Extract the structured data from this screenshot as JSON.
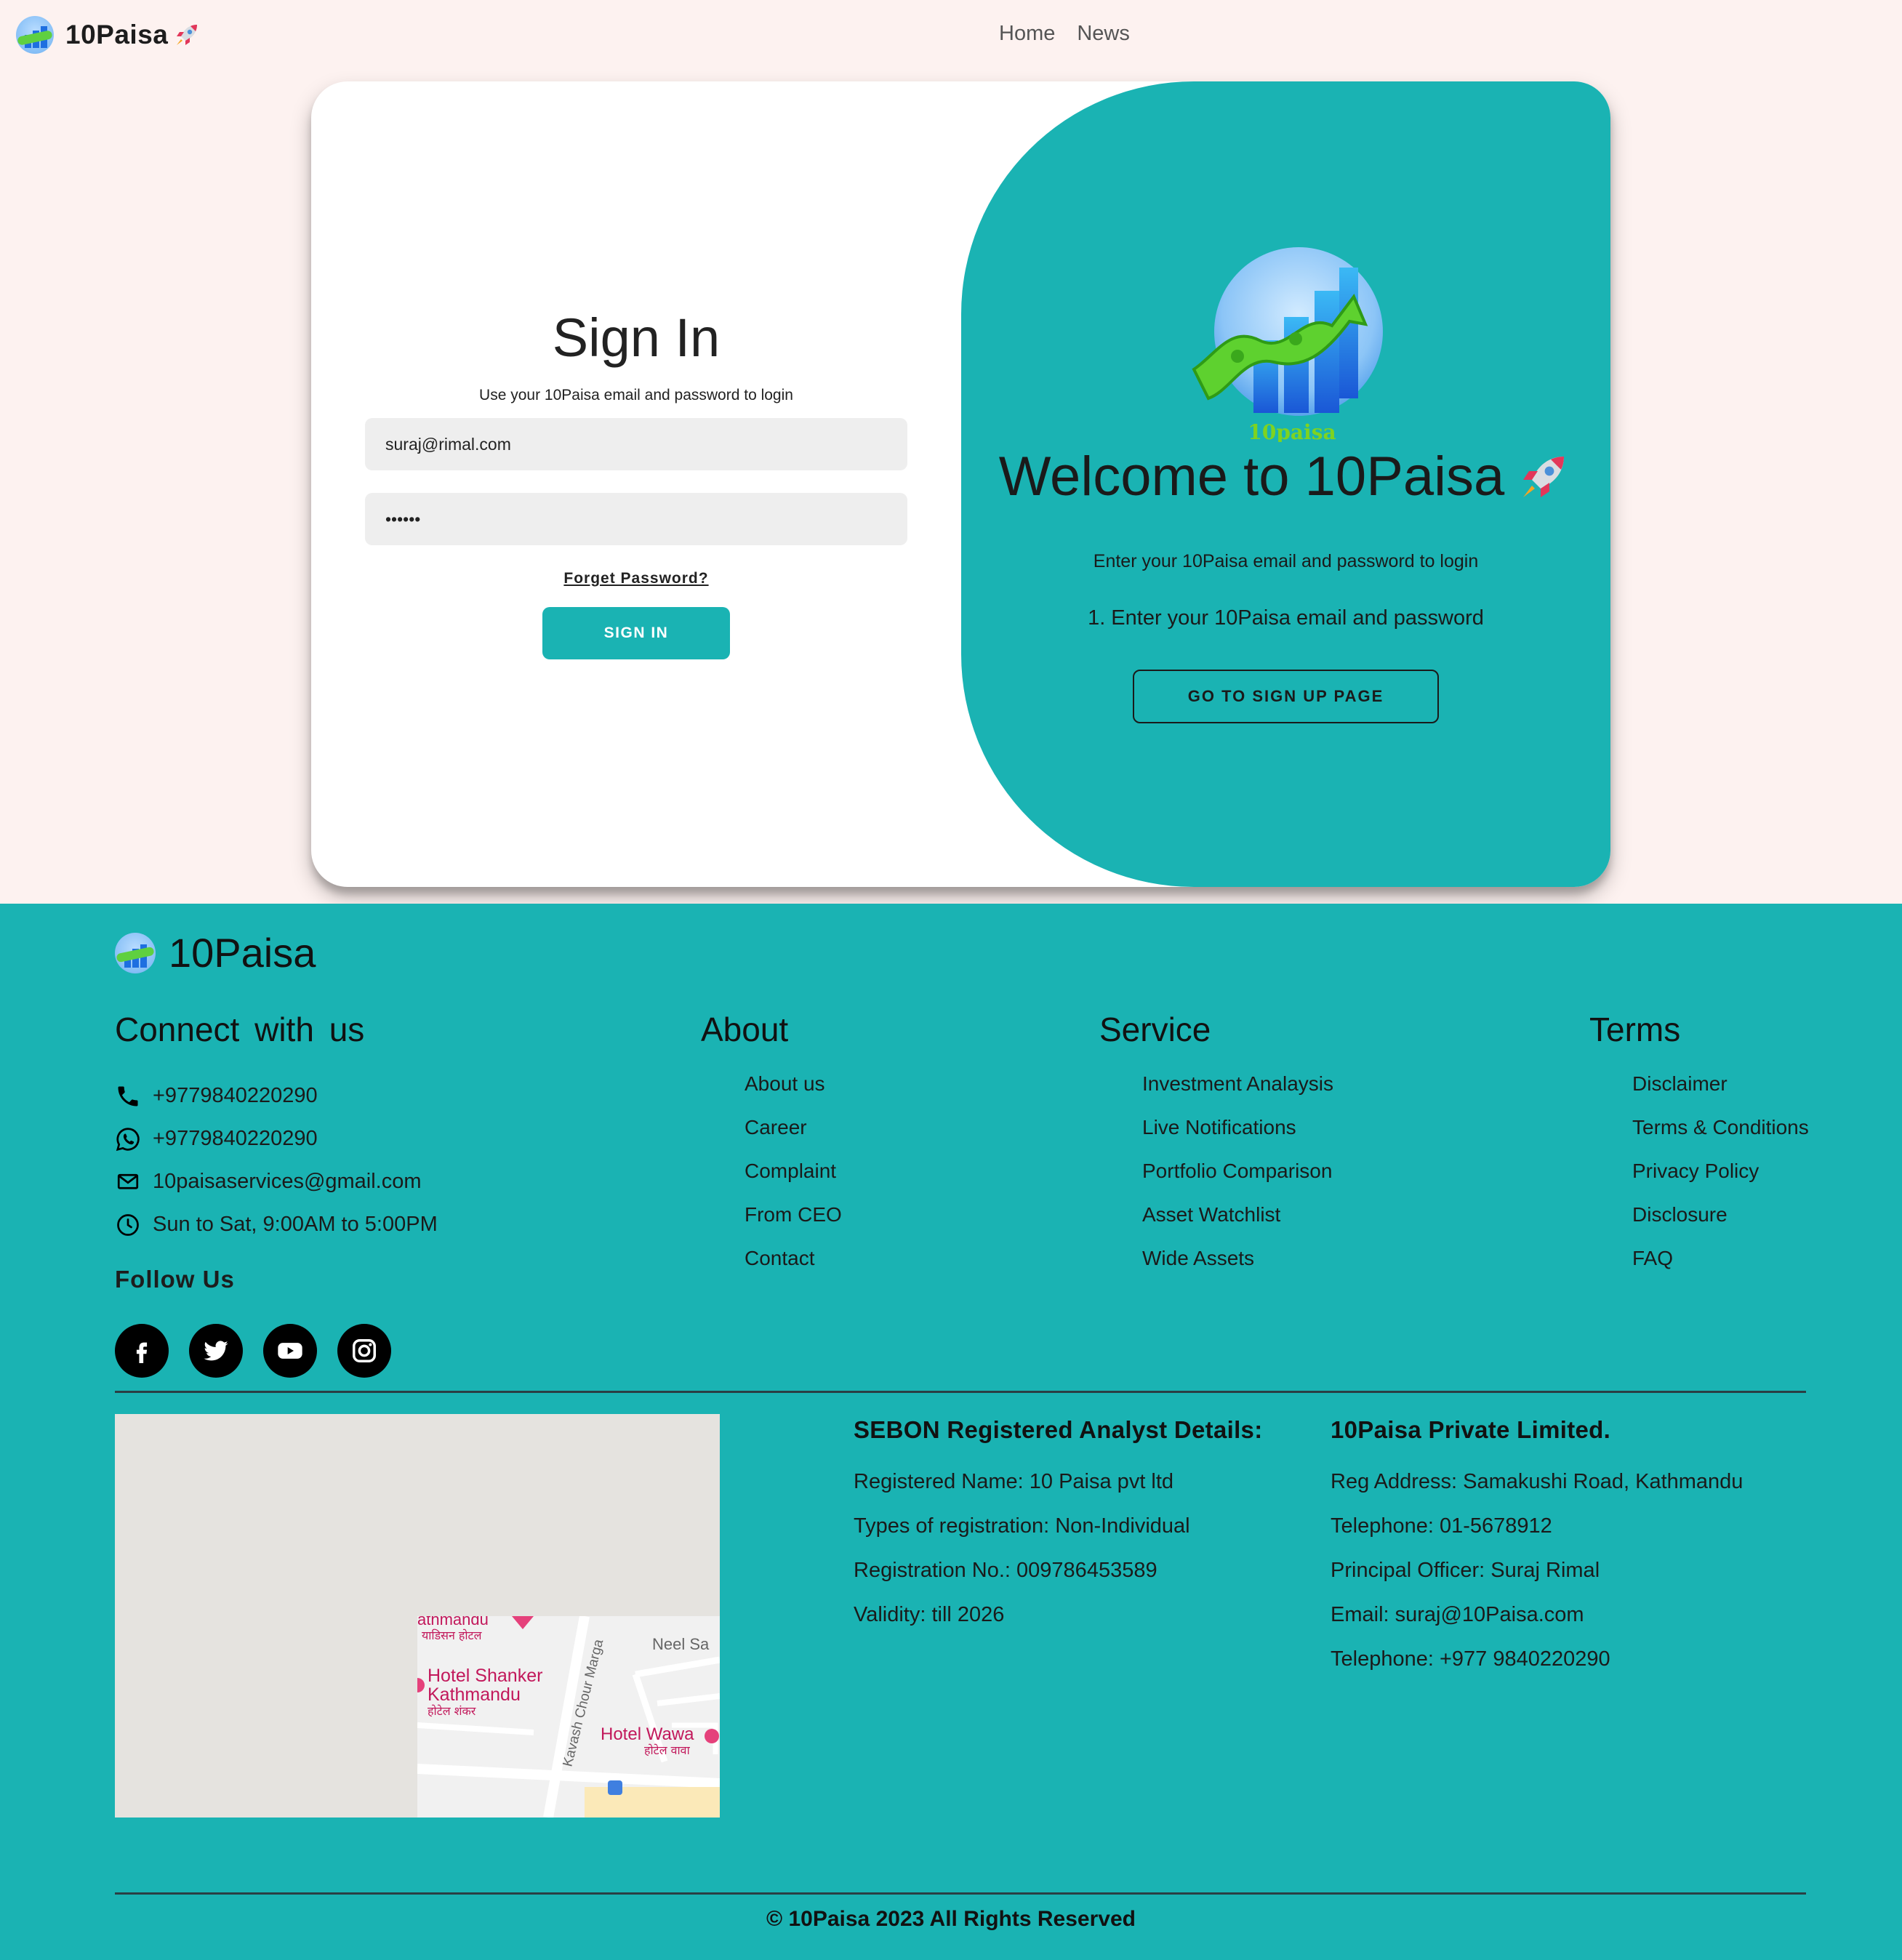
{
  "colors": {
    "accent": "#1ab3b3",
    "page_bg": "#fdf2f0",
    "text": "#1d1d1d"
  },
  "navbar": {
    "brand": "10Paisa",
    "brand_icon": "rocket-icon",
    "links": [
      "Home",
      "News"
    ]
  },
  "signin": {
    "title": "Sign In",
    "subtitle": "Use your 10Paisa email and password to login",
    "email_value": "suraj@rimal.com",
    "password_value": "••••••",
    "forgot_label": "Forget Password?",
    "submit_label": "SIGN IN"
  },
  "welcome": {
    "logo_text": "10paisa",
    "title": "Welcome to 10Paisa",
    "subtitle": "Enter your 10Paisa email and password to login",
    "step": "1. Enter your 10Paisa email and password",
    "signup_label": "GO TO SIGN UP PAGE"
  },
  "footer": {
    "brand": "10Paisa",
    "connect": {
      "title": "Connect with us",
      "items": [
        {
          "icon": "phone-icon",
          "text": "+9779840220290"
        },
        {
          "icon": "whatsapp-icon",
          "text": "+9779840220290"
        },
        {
          "icon": "mail-icon",
          "text": "10paisaservices@gmail.com"
        },
        {
          "icon": "clock-icon",
          "text": "Sun to Sat, 9:00AM to 5:00PM"
        }
      ],
      "follow_title": "Follow Us",
      "socials": [
        "facebook-icon",
        "twitter-icon",
        "youtube-icon",
        "instagram-icon"
      ]
    },
    "about": {
      "title": "About",
      "links": [
        "About us",
        "Career",
        "Complaint",
        "From CEO",
        "Contact"
      ]
    },
    "service": {
      "title": "Service",
      "links": [
        "Investment Analaysis",
        "Live Notifications",
        "Portfolio Comparison",
        "Asset Watchlist",
        "Wide Assets"
      ]
    },
    "terms": {
      "title": "Terms",
      "links": [
        "Disclaimer",
        "Terms & Conditions",
        "Privacy Policy",
        "Disclosure",
        "FAQ"
      ]
    },
    "map": {
      "labels": [
        "athmandu",
        "याडिसन होटल",
        "Hotel Shanker",
        "Kathmandu",
        "होटेल शंकर",
        "Kavash Chour Marga",
        "Neel Sa",
        "Hotel Wawa",
        "होटेल वावा"
      ]
    },
    "sebon": {
      "title": "SEBON Registered Analyst Details:",
      "lines": [
        "Registered Name: 10 Paisa pvt ltd",
        "Types of registration: Non-Individual",
        "Registration No.: 009786453589",
        "Validity: till 2026"
      ]
    },
    "company": {
      "title": "10Paisa Private Limited.",
      "lines": [
        "Reg Address: Samakushi Road, Kathmandu",
        "Telephone: 01-5678912",
        "Principal Officer: Suraj Rimal",
        "Email: suraj@10Paisa.com",
        "Telephone: +977 9840220290"
      ]
    },
    "copyright": "© 10Paisa 2023 All Rights Reserved"
  }
}
